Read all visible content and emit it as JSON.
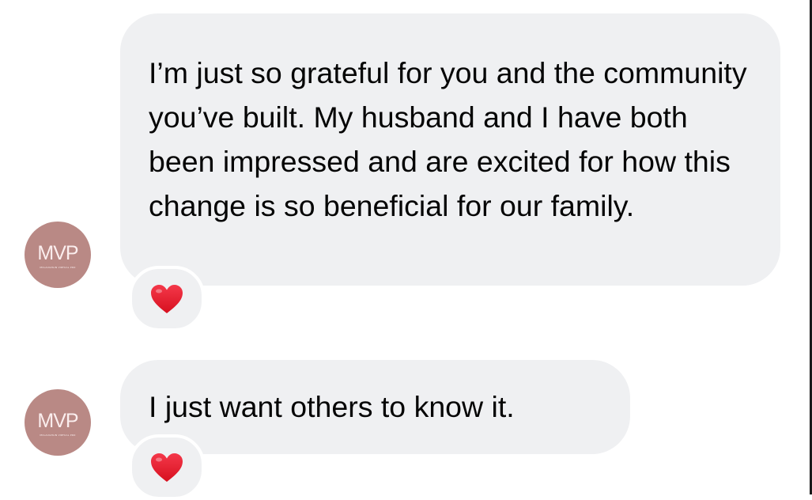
{
  "conversation": {
    "messages": [
      {
        "text": "I’m just so grateful for you and the community you’ve built. My husband and I have both been impressed and are excited for how this change is so beneficial for our family.",
        "reaction": "red-heart-icon"
      },
      {
        "text": "I just want others to know it.",
        "reaction": "red-heart-icon"
      }
    ],
    "avatar": {
      "logo_text": "MVP",
      "subtext": "MCLAUGHLIN VIRTUAL PRO"
    }
  },
  "colors": {
    "bubble_bg": "#eff0f2",
    "text": "#050505",
    "avatar_bg": "#b98985",
    "heart": "#e4182b"
  }
}
